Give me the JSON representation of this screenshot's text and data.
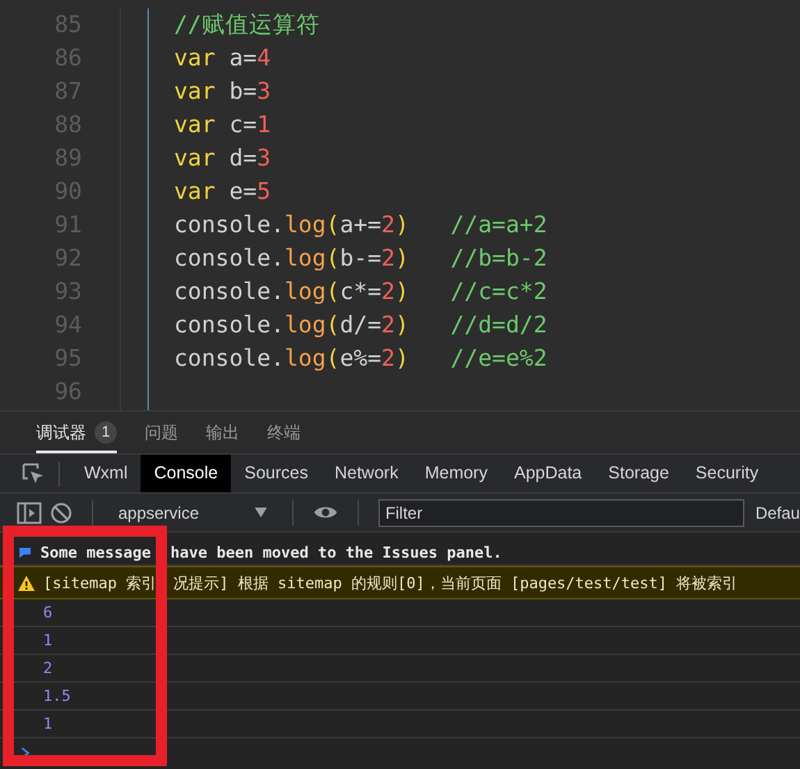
{
  "editor": {
    "lines": [
      {
        "number": "85",
        "tokens": [
          {
            "text": "//赋值运算符",
            "kind": "comment"
          }
        ]
      },
      {
        "number": "86",
        "tokens": [
          {
            "text": "var",
            "kind": "keyword"
          },
          {
            "text": " a=",
            "kind": "plain"
          },
          {
            "text": "4",
            "kind": "number"
          }
        ]
      },
      {
        "number": "87",
        "tokens": [
          {
            "text": "var",
            "kind": "keyword"
          },
          {
            "text": " b=",
            "kind": "plain"
          },
          {
            "text": "3",
            "kind": "number"
          }
        ]
      },
      {
        "number": "88",
        "tokens": [
          {
            "text": "var",
            "kind": "keyword"
          },
          {
            "text": " c=",
            "kind": "plain"
          },
          {
            "text": "1",
            "kind": "number"
          }
        ]
      },
      {
        "number": "89",
        "tokens": [
          {
            "text": "var",
            "kind": "keyword"
          },
          {
            "text": " d=",
            "kind": "plain"
          },
          {
            "text": "3",
            "kind": "number"
          }
        ]
      },
      {
        "number": "90",
        "tokens": [
          {
            "text": "var",
            "kind": "keyword"
          },
          {
            "text": " e=",
            "kind": "plain"
          },
          {
            "text": "5",
            "kind": "number"
          }
        ]
      },
      {
        "number": "91",
        "tokens": [
          {
            "text": "console.",
            "kind": "plain"
          },
          {
            "text": "log",
            "kind": "method"
          },
          {
            "text": "(",
            "kind": "paren"
          },
          {
            "text": "a+=",
            "kind": "plain"
          },
          {
            "text": "2",
            "kind": "number"
          },
          {
            "text": ")",
            "kind": "paren"
          },
          {
            "text": "   //a=a+2",
            "kind": "comment"
          }
        ]
      },
      {
        "number": "92",
        "tokens": [
          {
            "text": "console.",
            "kind": "plain"
          },
          {
            "text": "log",
            "kind": "method"
          },
          {
            "text": "(",
            "kind": "paren"
          },
          {
            "text": "b-=",
            "kind": "plain"
          },
          {
            "text": "2",
            "kind": "number"
          },
          {
            "text": ")",
            "kind": "paren"
          },
          {
            "text": "   //b=b-2",
            "kind": "comment"
          }
        ]
      },
      {
        "number": "93",
        "tokens": [
          {
            "text": "console.",
            "kind": "plain"
          },
          {
            "text": "log",
            "kind": "method"
          },
          {
            "text": "(",
            "kind": "paren"
          },
          {
            "text": "c*=",
            "kind": "plain"
          },
          {
            "text": "2",
            "kind": "number"
          },
          {
            "text": ")",
            "kind": "paren"
          },
          {
            "text": "   //c=c*2",
            "kind": "comment"
          }
        ]
      },
      {
        "number": "94",
        "tokens": [
          {
            "text": "console.",
            "kind": "plain"
          },
          {
            "text": "log",
            "kind": "method"
          },
          {
            "text": "(",
            "kind": "paren"
          },
          {
            "text": "d/=",
            "kind": "plain"
          },
          {
            "text": "2",
            "kind": "number"
          },
          {
            "text": ")",
            "kind": "paren"
          },
          {
            "text": "   //d=d/2",
            "kind": "comment"
          }
        ]
      },
      {
        "number": "95",
        "tokens": [
          {
            "text": "console.",
            "kind": "plain"
          },
          {
            "text": "log",
            "kind": "method"
          },
          {
            "text": "(",
            "kind": "paren"
          },
          {
            "text": "e%=",
            "kind": "plain"
          },
          {
            "text": "2",
            "kind": "number"
          },
          {
            "text": ")",
            "kind": "paren"
          },
          {
            "text": "   //e=e%2",
            "kind": "comment"
          }
        ]
      },
      {
        "number": "96"
      }
    ]
  },
  "devtools": {
    "panel_tabs": [
      {
        "label": "调试器",
        "selected": true,
        "badge": "1"
      },
      {
        "label": "问题",
        "selected": false
      },
      {
        "label": "输出",
        "selected": false
      },
      {
        "label": "终端",
        "selected": false
      }
    ],
    "tool_tabs": [
      {
        "label": "Wxml",
        "selected": false
      },
      {
        "label": "Console",
        "selected": true
      },
      {
        "label": "Sources",
        "selected": false
      },
      {
        "label": "Network",
        "selected": false
      },
      {
        "label": "Memory",
        "selected": false
      },
      {
        "label": "AppData",
        "selected": false
      },
      {
        "label": "Storage",
        "selected": false
      },
      {
        "label": "Security",
        "selected": false
      }
    ],
    "toolbar": {
      "context": "appservice",
      "filter": {
        "placeholder": "Filter"
      },
      "levels": "Defau"
    },
    "console": {
      "messages": [
        {
          "kind": "info",
          "parts": [
            "Some message",
            "have been moved to the Issues panel."
          ]
        },
        {
          "kind": "warning",
          "parts": [
            "[sitemap 索引",
            "况提示] 根据 sitemap 的规则[0]，当前页面 [pages/test/test] 将被索引"
          ]
        },
        {
          "kind": "output",
          "parts": [
            "6"
          ]
        },
        {
          "kind": "output",
          "parts": [
            "1"
          ]
        },
        {
          "kind": "output",
          "parts": [
            "2"
          ]
        },
        {
          "kind": "output",
          "parts": [
            "1.5"
          ]
        },
        {
          "kind": "output",
          "parts": [
            "1"
          ]
        }
      ]
    }
  },
  "highlight_frame": true
}
